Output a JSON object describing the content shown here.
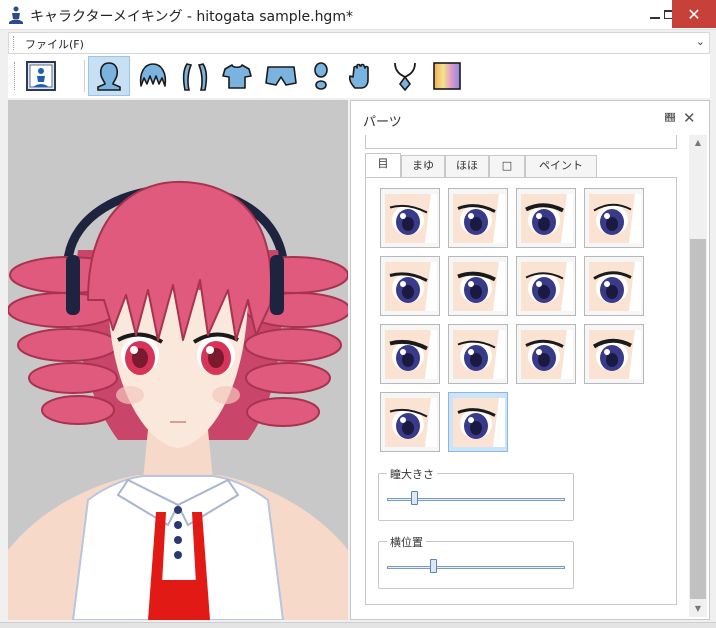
{
  "window": {
    "title": "キャラクターメイキング - hitogata sample.hgm*",
    "close_glyph": "✕"
  },
  "menu": {
    "file_label": "ファイル(F)",
    "overflow_glyph": "⌄"
  },
  "toolbar": {
    "buttons": [
      {
        "icon": "character-info-icon"
      },
      {
        "icon": "head-icon",
        "active": true
      },
      {
        "icon": "front-hair-icon"
      },
      {
        "icon": "back-hair-icon"
      },
      {
        "icon": "shirt-icon"
      },
      {
        "icon": "pants-icon"
      },
      {
        "icon": "shoes-icon"
      },
      {
        "icon": "hand-icon"
      },
      {
        "icon": "accessory-icon"
      },
      {
        "icon": "color-palette-icon"
      }
    ]
  },
  "panel": {
    "title": "パーツ",
    "pin_glyph": "𝍘",
    "close_glyph": "✕",
    "tabs": [
      {
        "label": "目",
        "active": true
      },
      {
        "label": "まゆ"
      },
      {
        "label": "ほほ"
      },
      {
        "label": "□"
      },
      {
        "label": "ペイント"
      }
    ],
    "eye_variants_count": 14,
    "selected_eye_index": 13,
    "sliders": [
      {
        "label": "瞳大きさ",
        "value": 0.15
      },
      {
        "label": "横位置",
        "value": 0.26
      }
    ]
  },
  "colors": {
    "accent": "#c8e0f4",
    "close_button": "#c7413a",
    "hair": "#e05a7e",
    "skin": "#fbe8dc",
    "tie": "#e11a16",
    "eye_iris": "#3a3a8a"
  }
}
